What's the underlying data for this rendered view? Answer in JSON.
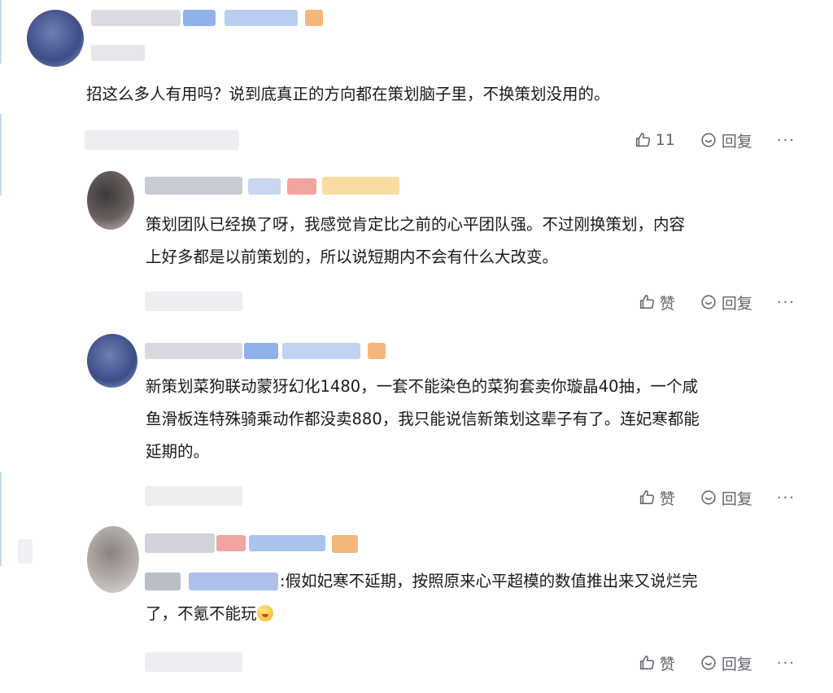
{
  "comments": [
    {
      "text": "招这么多人有用吗？说到底真正的方向都在策划脑子里，不换策划没用的。",
      "like_label": "11",
      "reply_label": "回复",
      "more_label": "···"
    },
    {
      "lines": [
        "策划团队已经换了呀，我感觉肯定比之前的心平团队强。不过刚换策划，内容",
        "上好多都是以前策划的，所以说短期内不会有什么大改变。"
      ],
      "like_label": "赞",
      "reply_label": "回复",
      "more_label": "···"
    },
    {
      "lines": [
        "新策划菜狗联动蒙犽幻化1480，一套不能染色的菜狗套卖你璇晶40抽，一个咸",
        "鱼滑板连特殊骑乘动作都没卖880，我只能说信新策划这辈子有了。连妃寒都能",
        "延期的。"
      ],
      "like_label": "赞",
      "reply_label": "回复",
      "more_label": "···"
    },
    {
      "line1": ":假如妃寒不延期，按照原来心平超模的数值推出来又说烂完",
      "line2": "了，不氪不能玩",
      "like_label": "赞",
      "reply_label": "回复",
      "more_label": "···"
    }
  ],
  "icons": {
    "like": "thumbs-up-icon",
    "reply": "speech-bubble-icon",
    "more": "ellipsis-icon",
    "emoji": "laughing-emoji-icon"
  },
  "colors": {
    "text": "#18191c",
    "secondary": "#61666d",
    "accent_line": "#c9d9f3"
  }
}
